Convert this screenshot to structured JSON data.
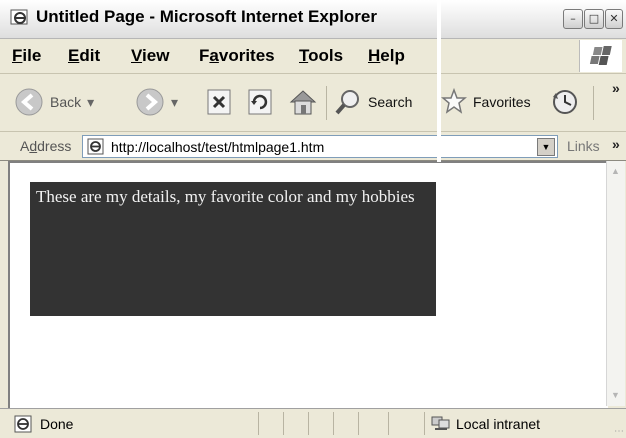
{
  "window": {
    "title": "Untitled Page - Microsoft Internet Explorer"
  },
  "menu": {
    "items": [
      {
        "label": "File",
        "accel": "F",
        "rest": "ile"
      },
      {
        "label": "Edit",
        "accel": "E",
        "rest": "dit"
      },
      {
        "label": "View",
        "accel": "V",
        "rest": "iew"
      },
      {
        "label": "Favorites",
        "pre": "F",
        "accel": "a",
        "rest": "vorites"
      },
      {
        "label": "Tools",
        "accel": "T",
        "rest": "ools"
      },
      {
        "label": "Help",
        "accel": "H",
        "rest": "elp"
      }
    ]
  },
  "toolbar": {
    "back_label": "Back",
    "search_label": "Search",
    "favorites_label": "Favorites"
  },
  "address": {
    "label_pre": "A",
    "label_accel": "d",
    "label_rest": "dress",
    "url": "http://localhost/test/htmlpage1.htm",
    "links_label": "Links"
  },
  "content": {
    "detail_text": "These are my details, my favorite color and my hobbies"
  },
  "status": {
    "text": "Done",
    "zone": "Local intranet"
  },
  "colors": {
    "detail_bg": "#333333",
    "detail_fg": "#f2f2f2",
    "chrome_bg": "#ece9d8"
  }
}
